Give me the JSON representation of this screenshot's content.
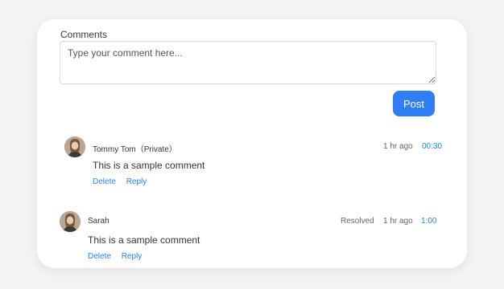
{
  "form": {
    "label": "Comments",
    "placeholder": "Type your comment here...",
    "post_label": "Post"
  },
  "comments": [
    {
      "author": "Tommy Tom（Private）",
      "status": "",
      "time_ago": "1 hr ago",
      "timestamp": "00:30",
      "text": "This is a sample comment",
      "delete_label": "Delete",
      "reply_label": "Reply"
    },
    {
      "author": "Sarah",
      "status": "Resolved",
      "time_ago": "1 hr ago",
      "timestamp": "1:00",
      "text": "This is a sample comment",
      "delete_label": "Delete",
      "reply_label": "Reply"
    }
  ],
  "colors": {
    "accent": "#2f7ef6",
    "card_bg": "#ffffff",
    "page_bg": "#f4f4f5"
  }
}
